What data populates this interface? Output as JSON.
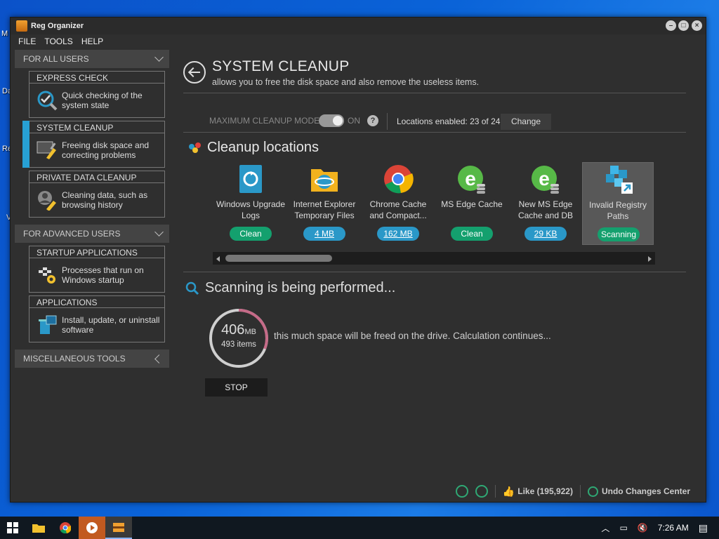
{
  "desktop": {
    "icons": [
      "M",
      "Da",
      "Re",
      "V"
    ]
  },
  "window": {
    "title": "Reg Organizer",
    "controls": [
      "minimize",
      "maximize",
      "close"
    ]
  },
  "menu": [
    "FILE",
    "TOOLS",
    "HELP"
  ],
  "sidebar": {
    "section_all_users": "FOR ALL USERS",
    "express_check": {
      "title": "EXPRESS CHECK",
      "desc": "Quick checking of the system state"
    },
    "system_cleanup": {
      "title": "SYSTEM CLEANUP",
      "desc": "Freeing disk space and correcting problems"
    },
    "private_data": {
      "title": "PRIVATE DATA CLEANUP",
      "desc": "Cleaning data, such as browsing history"
    },
    "section_advanced": "FOR ADVANCED USERS",
    "startup": {
      "title": "STARTUP APPLICATIONS",
      "desc": "Processes that run on Windows startup"
    },
    "applications": {
      "title": "APPLICATIONS",
      "desc": "Install, update, or uninstall software"
    },
    "section_misc": "MISCELLANEOUS TOOLS"
  },
  "main": {
    "title": "SYSTEM CLEANUP",
    "subtitle": "allows you to free the disk space and also remove the useless items.",
    "max_mode_label": "MAXIMUM CLEANUP MODE",
    "toggle_state": "ON",
    "help": "?",
    "locations_enabled": "Locations enabled: 23 of 24",
    "change_label": "Change",
    "locations_title": "Cleanup locations",
    "tiles": [
      {
        "label": "Windows Upgrade Logs",
        "badge": "Clean",
        "status": "clean",
        "icon": "windows-upgrade-icon"
      },
      {
        "label": "Internet Explorer Temporary Files",
        "badge": "4 MB",
        "status": "size",
        "icon": "internet-explorer-icon"
      },
      {
        "label": "Chrome Cache and Compact...",
        "badge": "162 MB",
        "status": "size",
        "icon": "chrome-icon"
      },
      {
        "label": "MS Edge Cache",
        "badge": "Clean",
        "status": "clean",
        "icon": "ms-edge-icon"
      },
      {
        "label": "New MS Edge Cache and DB",
        "badge": "29 KB",
        "status": "size",
        "icon": "new-ms-edge-icon"
      },
      {
        "label": "Invalid Registry Paths",
        "badge": "Scanning",
        "status": "clean",
        "icon": "registry-cubes-icon"
      }
    ],
    "scan_title": "Scanning is being performed...",
    "ring_value": "406",
    "ring_unit": "MB",
    "ring_items": "493 items",
    "scan_desc": "this much space will be freed on the drive. Calculation continues...",
    "stop_label": "STOP"
  },
  "statusbar": {
    "like": "Like (195,922)",
    "undo": "Undo Changes Center"
  },
  "taskbar": {
    "time": "7:26 AM"
  },
  "colors": {
    "accent": "#27a0d4",
    "green": "#14a06e",
    "blue_badge": "#2a98c8"
  }
}
